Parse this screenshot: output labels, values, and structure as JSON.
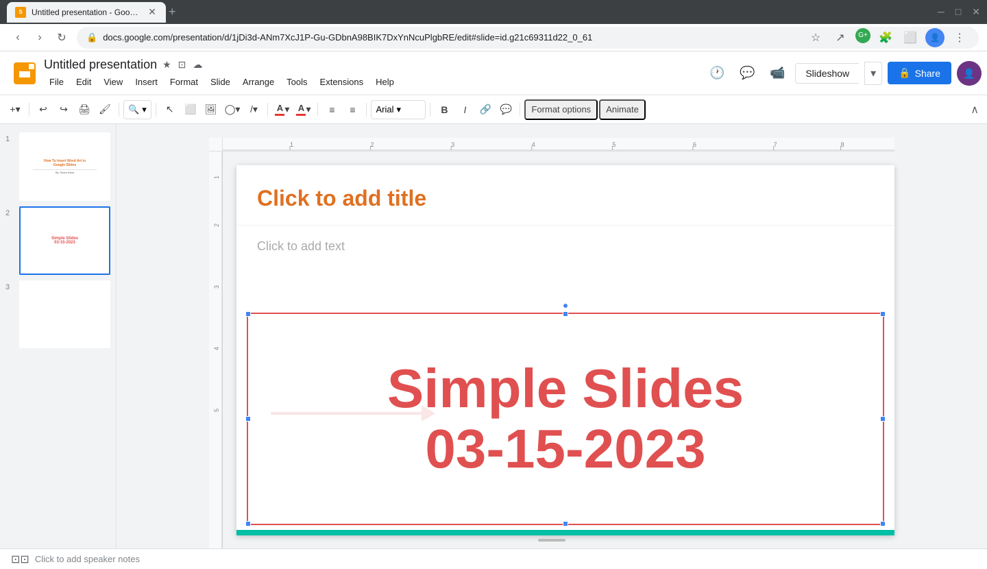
{
  "browser": {
    "tab_title": "Untitled presentation - Google S",
    "url": "docs.google.com/presentation/d/1jDi3d-ANm7XcJ1P-Gu-GDbnA98BIK7DxYnNcuPlgbRE/edit#slide=id.g21c69311d22_0_61",
    "new_tab_label": "+",
    "window_controls": {
      "minimize": "─",
      "maximize": "□",
      "close": "✕"
    }
  },
  "app": {
    "title": "Untitled presentation",
    "title_icons": [
      "★",
      "⊡",
      "☁"
    ],
    "menu": [
      "File",
      "Edit",
      "View",
      "Insert",
      "Format",
      "Slide",
      "Arrange",
      "Tools",
      "Extensions",
      "Help"
    ],
    "header_buttons": {
      "history": "🕐",
      "comments": "💬",
      "video": "📹",
      "slideshow": "Slideshow",
      "share": "Share"
    }
  },
  "toolbar": {
    "zoom_label": "▾",
    "undo": "↩",
    "redo": "↪",
    "print": "🖨",
    "format_paint": "🖌",
    "zoom": "🔍",
    "cursor_tool": "↖",
    "select_rect": "⬜",
    "image": "🖼",
    "shapes": "◯",
    "line": "/",
    "font_color": "A",
    "highlight_color": "A",
    "align_left": "≡",
    "align_center": "≡",
    "font_name": "Arial",
    "bold": "B",
    "italic": "I",
    "link": "🔗",
    "comment": "💬",
    "format_options": "Format options",
    "animate": "Animate",
    "collapse": "∧"
  },
  "slides": [
    {
      "number": "1",
      "title_thumb": "How To Insert Word Art in Google Slides",
      "subtitle_thumb": "By: Kideo Astra"
    },
    {
      "number": "2",
      "text_thumb": "Simple Slides\n03-15-2023"
    },
    {
      "number": "3",
      "text_thumb": ""
    }
  ],
  "slide_content": {
    "title_placeholder": "Click to add title",
    "text_placeholder": "Click to add text",
    "text_box_line1": "Simple Slides",
    "text_box_line2": "03-15-2023",
    "bottom_bar_color": "#00bfa5"
  },
  "speaker_notes": "Click to add speaker notes"
}
